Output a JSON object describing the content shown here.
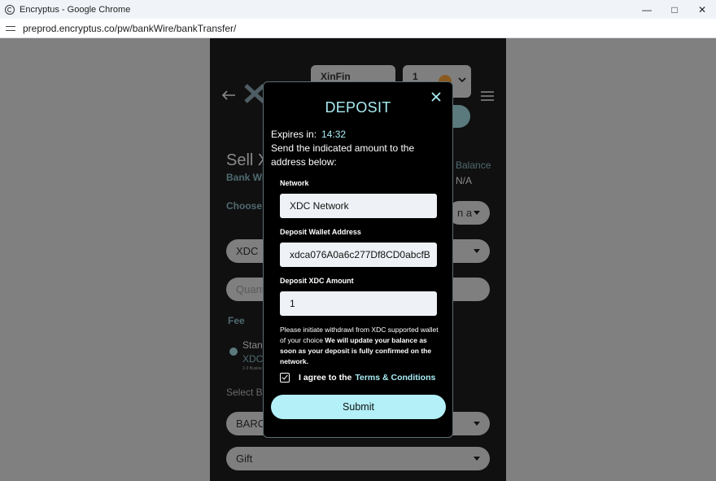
{
  "browser": {
    "window_title": "Encryptus - Google Chrome",
    "url": "preprod.encryptus.co/pw/bankWire/bankTransfer/"
  },
  "background": {
    "network_select": "XinFin",
    "quantity_select": "1",
    "page_title": "Sell X",
    "subtitle": "Bank Wi",
    "balance_label": "Balance",
    "balance_value": "N/A",
    "choose_label": "Choose",
    "choose_right": "n a",
    "coin_select": "XDC",
    "quantity_placeholder": "Quant",
    "fee_label": "Fee",
    "fee_option": "Stan",
    "fee_sub": "XDC",
    "fee_small": "2-3 Busine",
    "select_bank_label": "Select Ba",
    "bank_select": "BARC",
    "purpose_select": "Gift"
  },
  "modal": {
    "title": "DEPOSIT",
    "expires_label": "Expires in:",
    "expires_value": "14:32",
    "instruction": "Send the indicated amount to the address below:",
    "network_label": "Network",
    "network_value": "XDC Network",
    "address_label": "Deposit Wallet Address",
    "address_value": "xdca076A0a6c277Df8CD0abcfB",
    "amount_label": "Deposit XDC Amount",
    "amount_value": "1",
    "notice_plain": "Please initiate withdrawl from XDC supported wallet of your choice ",
    "notice_bold": "We will update your balance as soon as your deposit is fully confirmed on the network.",
    "agree_text": "I agree to the",
    "terms_link": "Terms & Conditions",
    "submit_label": "Submit"
  },
  "colors": {
    "accent": "#a9ecf4",
    "submit_bg": "#b3f0f8",
    "modal_bg": "#000000"
  }
}
